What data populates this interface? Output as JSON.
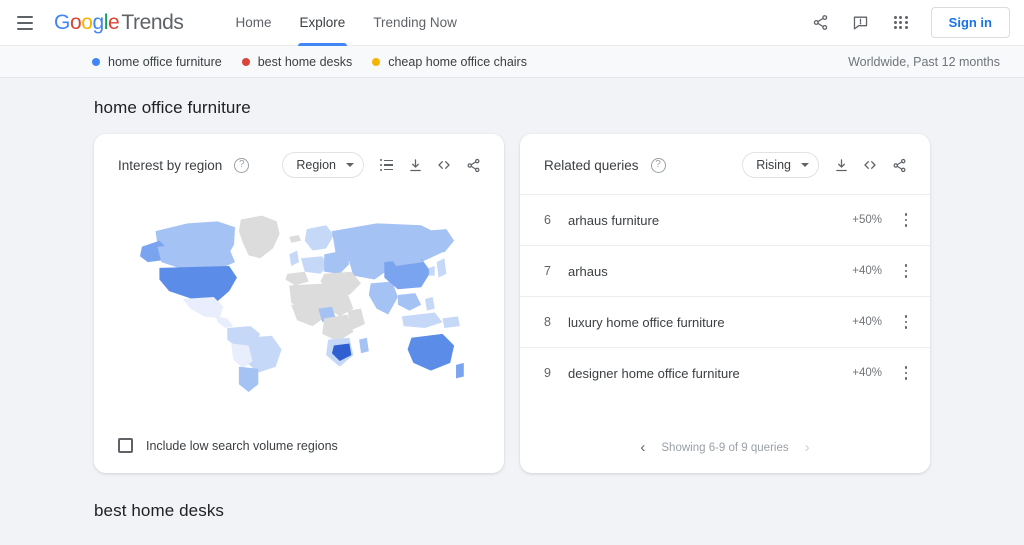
{
  "nav": {
    "menu_icon": "hamburger-icon",
    "logo": {
      "g1": "G",
      "o1": "o",
      "o2": "o",
      "g2": "g",
      "l": "l",
      "e": "e",
      "suffix": "Trends"
    },
    "links": [
      {
        "label": "Home",
        "active": false
      },
      {
        "label": "Explore",
        "active": true
      },
      {
        "label": "Trending Now",
        "active": false
      }
    ],
    "share_icon": "share-icon",
    "feedback_icon": "feedback-icon",
    "apps_icon": "apps-grid-icon",
    "sign_in_label": "Sign in"
  },
  "legend": {
    "items": [
      {
        "label": "home office furniture",
        "color": "#4285F4"
      },
      {
        "label": "best home desks",
        "color": "#DB4437"
      },
      {
        "label": "cheap home office chairs",
        "color": "#F4B400"
      }
    ],
    "meta": "Worldwide, Past 12 months"
  },
  "section": {
    "title": "home office furniture"
  },
  "region_card": {
    "title": "Interest by region",
    "help": "?",
    "dropdown_label": "Region",
    "tools": [
      {
        "name": "list-view-icon"
      },
      {
        "name": "download-icon"
      },
      {
        "name": "embed-code-icon"
      },
      {
        "name": "share-icon"
      }
    ],
    "checkbox_label": "Include low search volume regions",
    "checkbox_checked": false
  },
  "queries_card": {
    "title": "Related queries",
    "help": "?",
    "dropdown_label": "Rising",
    "tools": [
      {
        "name": "download-icon"
      },
      {
        "name": "embed-code-icon"
      },
      {
        "name": "share-icon"
      }
    ],
    "rows": [
      {
        "rank": "6",
        "query": "arhaus furniture",
        "change": "+50%"
      },
      {
        "rank": "7",
        "query": "arhaus",
        "change": "+40%"
      },
      {
        "rank": "8",
        "query": "luxury home office furniture",
        "change": "+40%"
      },
      {
        "rank": "9",
        "query": "designer home office furniture",
        "change": "+40%"
      }
    ],
    "pager": {
      "prev_icon": "chevron-left-icon",
      "text": "Showing 6-9 of 9 queries",
      "next_icon": "chevron-right-icon"
    }
  },
  "bottom_section": {
    "title": "best home desks"
  },
  "colors": {
    "accent": "#4285F4",
    "page_bg": "#f1f3f6",
    "map_no_data": "#dcdcdc",
    "map_l1": "#e8eefc",
    "map_l2": "#c6d8f8",
    "map_l3": "#a4c2f4",
    "map_l4": "#7ba4f0",
    "map_l5": "#5b8de8",
    "map_l6": "#2f5fd0"
  }
}
